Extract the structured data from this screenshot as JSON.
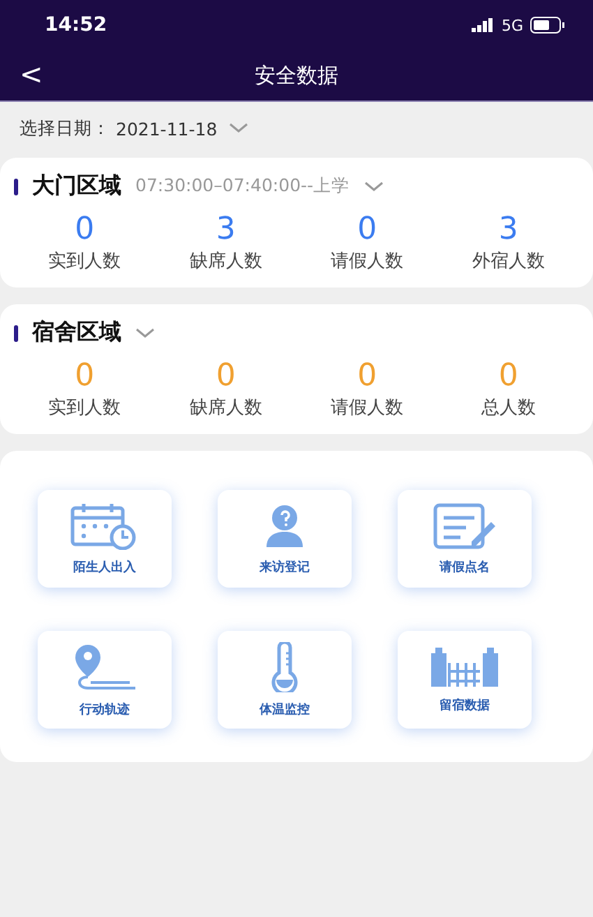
{
  "status_bar": {
    "time": "14:52",
    "network": "5G"
  },
  "nav": {
    "back": "<",
    "title": "安全数据"
  },
  "date_filter": {
    "label": "选择日期：",
    "value": "2021-11-18"
  },
  "areas": [
    {
      "title": "大门区域",
      "subtitle": "07:30:00–07:40:00--上学",
      "color": "#3b7cf0",
      "stats": [
        {
          "value": "0",
          "label": "实到人数"
        },
        {
          "value": "3",
          "label": "缺席人数"
        },
        {
          "value": "0",
          "label": "请假人数"
        },
        {
          "value": "3",
          "label": "外宿人数"
        }
      ]
    },
    {
      "title": "宿舍区域",
      "color": "#f0a030",
      "stats": [
        {
          "value": "0",
          "label": "实到人数"
        },
        {
          "value": "0",
          "label": "缺席人数"
        },
        {
          "value": "0",
          "label": "请假人数"
        },
        {
          "value": "0",
          "label": "总人数"
        }
      ]
    }
  ],
  "tiles": [
    "陌生人出入",
    "来访登记",
    "请假点名",
    "行动轨迹",
    "体温监控",
    "留宿数据"
  ]
}
